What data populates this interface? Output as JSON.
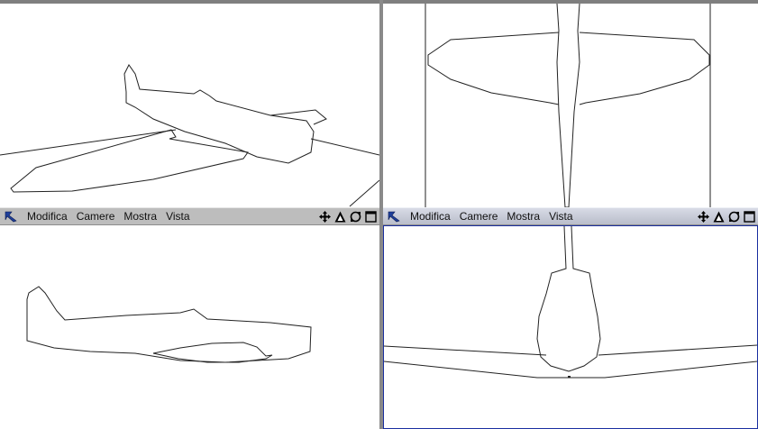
{
  "viewports": {
    "top_left": {
      "menu": [
        "Modifica",
        "Camere",
        "Mostra",
        "Vista"
      ]
    },
    "top_right": {
      "menu": [
        "Modifica",
        "Camere",
        "Mostra",
        "Vista"
      ]
    }
  },
  "icons": {
    "app": "cinema-app-icon",
    "move": "move-view-icon",
    "scale": "scale-view-icon",
    "rotate": "rotate-view-icon",
    "maximize": "maximize-view-icon"
  },
  "colors": {
    "active_border": "#1a2fa0",
    "viewport_bg": "#ffffff",
    "wire": "#222222"
  }
}
